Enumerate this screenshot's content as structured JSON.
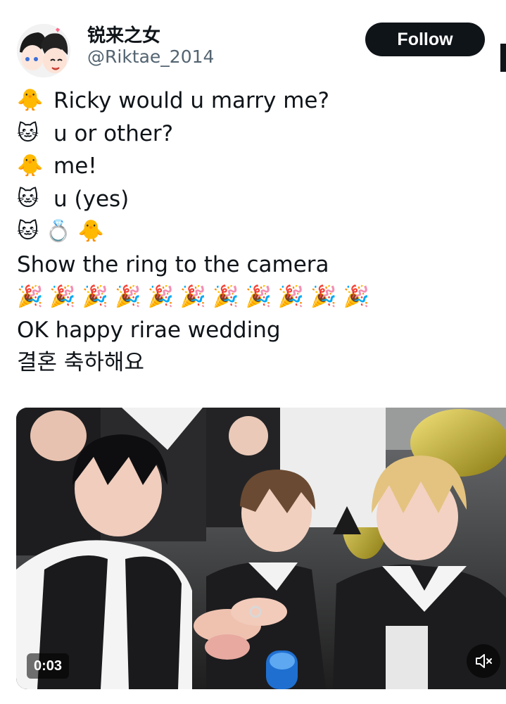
{
  "status_strip": "· · ·",
  "user": {
    "display_name": "锐来之女",
    "handle": "@Riktae_2014",
    "avatar_icon": "avatar-illustration"
  },
  "follow_button": {
    "label": "Follow"
  },
  "tweet": {
    "lines": [
      {
        "emoji": "🐥",
        "text": "Ricky would u marry me?"
      },
      {
        "emoji": "🐱",
        "text": "u or other?"
      },
      {
        "emoji": "🐥",
        "text": "me!"
      },
      {
        "emoji": "🐱",
        "text": "u (yes)"
      },
      {
        "emoji_sequence": [
          "🐱",
          "💍",
          "🐥"
        ]
      },
      {
        "text": "Show the ring to the camera"
      },
      {
        "emoji_sequence": [
          "🎉",
          "🎉",
          "🎉",
          "🎉",
          "🎉",
          "🎉",
          "🎉",
          "🎉",
          "🎉",
          "🎉",
          "🎉"
        ]
      },
      {
        "text": "OK happy rirae wedding"
      },
      {
        "text": "결혼 축하해요"
      }
    ]
  },
  "video": {
    "timestamp": "0:03",
    "mute_icon": "speaker-muted-icon"
  },
  "colors": {
    "text_primary": "#0f1419",
    "text_secondary": "#536471",
    "button_bg": "#0f1419",
    "button_text": "#ffffff"
  }
}
